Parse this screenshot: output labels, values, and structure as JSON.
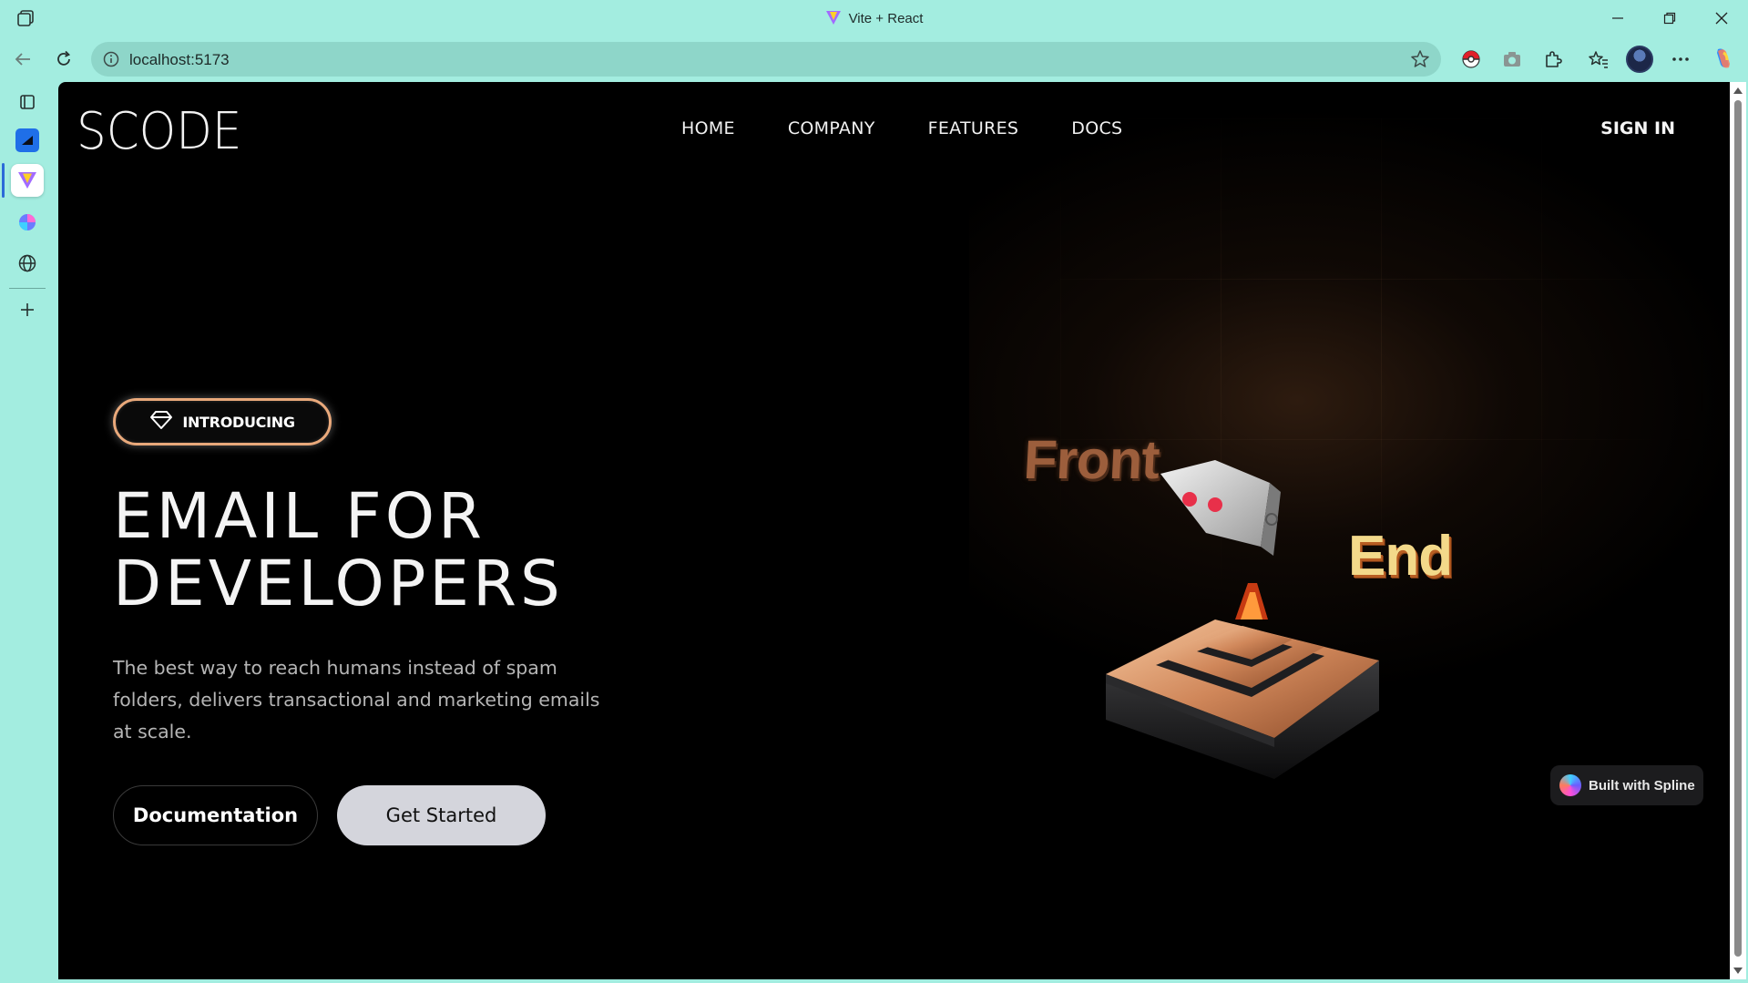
{
  "browser": {
    "window_title": "Vite + React",
    "address_url": "localhost:5173",
    "toolbar_icons": [
      "workspaces-icon",
      "back-icon",
      "reload-icon",
      "site-info-icon",
      "favorite-star-icon",
      "pokeball-extension-icon",
      "camera-icon",
      "extensions-icon",
      "favorites-icon",
      "profile-avatar",
      "more-icon",
      "copilot-icon"
    ],
    "window_controls": [
      "minimize-icon",
      "restore-icon",
      "close-icon"
    ]
  },
  "sidebar": {
    "tabs": [
      {
        "name": "tab-actions-icon"
      },
      {
        "name": "blue-app-tab-icon"
      },
      {
        "name": "vite-tab-icon",
        "active": true
      },
      {
        "name": "copilot-tab-icon"
      },
      {
        "name": "globe-tab-icon"
      },
      {
        "name": "new-tab-plus-icon"
      }
    ]
  },
  "page": {
    "logo": "SCODE",
    "nav": [
      "HOME",
      "COMPANY",
      "FEATURES",
      "DOCS"
    ],
    "sign_in": "SIGN IN",
    "badge": "INTRODUCING",
    "title_line1": "EMAIL FOR",
    "title_line2": "DEVELOPERS",
    "subtitle": "The best way to reach humans instead of spam folders, delivers transactional and marketing emails at scale.",
    "btn_documentation": "Documentation",
    "btn_get_started": "Get Started",
    "scene_text_front": "Front",
    "scene_text_end": "End",
    "spline_badge": "Built with Spline"
  },
  "colors": {
    "browser_bg": "#a3ede0",
    "page_bg": "#000000",
    "pill_border": "#e9a97b",
    "get_started_bg": "#d4d5dc",
    "front_text": "#9c5e3c",
    "end_text": "#f3d98a"
  }
}
